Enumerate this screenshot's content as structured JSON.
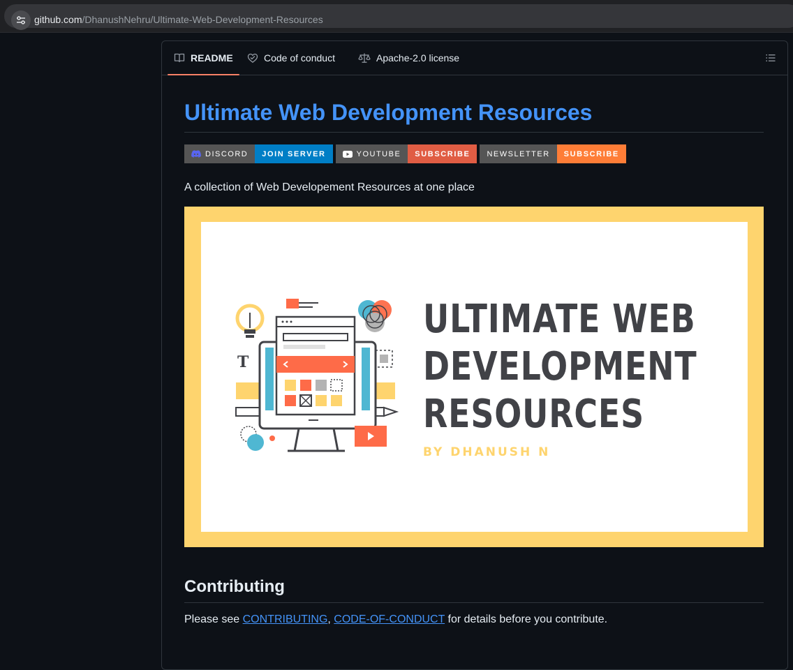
{
  "browser": {
    "url_host": "github.com",
    "url_path": "/DhanushNehru/Ultimate-Web-Development-Resources"
  },
  "tabs": [
    {
      "label": "README",
      "icon": "book-icon",
      "active": true
    },
    {
      "label": "Code of conduct",
      "icon": "code-of-conduct-icon"
    },
    {
      "label": "Apache-2.0 license",
      "icon": "law-icon"
    }
  ],
  "readme": {
    "title": "Ultimate Web Development Resources",
    "badges": [
      {
        "left": "DISCORD",
        "right": "JOIN SERVER",
        "icon": "discord-icon",
        "color": "#007ec6"
      },
      {
        "left": "YOUTUBE",
        "right": "SUBSCRIBE",
        "icon": "youtube-icon",
        "color": "#e05d44"
      },
      {
        "left": "NEWSLETTER",
        "right": "SUBSCRIBE",
        "color": "#fe7d37"
      }
    ],
    "description": "A collection of Web Developement Resources at one place",
    "banner": {
      "line1": "ULTIMATE WEB",
      "line2": "DEVELOPMENT",
      "line3": "RESOURCES",
      "byline": "BY DHANUSH N"
    },
    "contributing": {
      "heading": "Contributing",
      "text_before": "Please see ",
      "link1": "CONTRIBUTING",
      "separator": ", ",
      "link2": "CODE-OF-CONDUCT",
      "text_after": " for details before you contribute."
    }
  },
  "colors": {
    "accent_link": "#4493f8",
    "tab_underline": "#f78166",
    "banner_frame": "#fed46e",
    "banner_title": "#414247"
  }
}
